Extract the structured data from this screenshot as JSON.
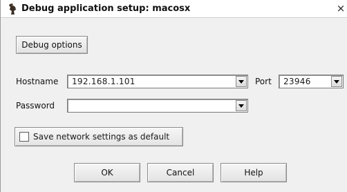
{
  "window": {
    "title": "Debug application setup: macosx",
    "close_glyph": "×"
  },
  "buttons": {
    "debug_options": "Debug options",
    "ok": "OK",
    "cancel": "Cancel",
    "help": "Help"
  },
  "fields": {
    "hostname": {
      "label": "Hostname",
      "value": "192.168.1.101"
    },
    "port": {
      "label": "Port",
      "value": "23946"
    },
    "password": {
      "label": "Password",
      "value": ""
    }
  },
  "checkbox": {
    "label": "Save network settings as default",
    "checked": false
  },
  "icons": {
    "app": "ida-app-icon",
    "close": "close-icon",
    "dropdown": "chevron-down-icon"
  }
}
